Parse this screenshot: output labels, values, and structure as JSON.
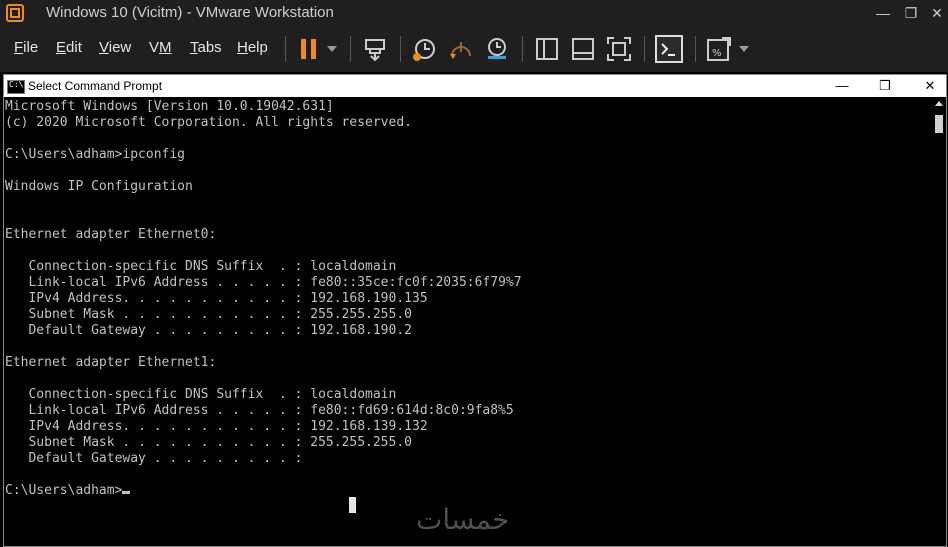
{
  "vm": {
    "title": "Windows 10 (Vicitm) - VMware Workstation",
    "menu": [
      "File",
      "Edit",
      "View",
      "VM",
      "Tabs",
      "Help"
    ],
    "menu_mnemonic": [
      "F",
      "E",
      "V",
      "M",
      "T",
      "H"
    ],
    "accent": "#f08a24"
  },
  "cmd": {
    "title": "Select Command Prompt",
    "icon_text": "C:\\",
    "lines": [
      "Microsoft Windows [Version 10.0.19042.631]",
      "(c) 2020 Microsoft Corporation. All rights reserved.",
      "",
      "C:\\Users\\adham>ipconfig",
      "",
      "Windows IP Configuration",
      "",
      "",
      "Ethernet adapter Ethernet0:",
      "",
      "   Connection-specific DNS Suffix  . : localdomain",
      "   Link-local IPv6 Address . . . . . : fe80::35ce:fc0f:2035:6f79%7",
      "   IPv4 Address. . . . . . . . . . . : 192.168.190.135",
      "   Subnet Mask . . . . . . . . . . . : 255.255.255.0",
      "   Default Gateway . . . . . . . . . : 192.168.190.2",
      "",
      "Ethernet adapter Ethernet1:",
      "",
      "   Connection-specific DNS Suffix  . : localdomain",
      "   Link-local IPv6 Address . . . . . : fe80::fd69:614d:8c0:9fa8%5",
      "   IPv4 Address. . . . . . . . . . . : 192.168.139.132",
      "   Subnet Mask . . . . . . . . . . . : 255.255.255.0",
      "   Default Gateway . . . . . . . . . :",
      ""
    ],
    "prompt": "C:\\Users\\adham>"
  },
  "watermark": "خمسات"
}
